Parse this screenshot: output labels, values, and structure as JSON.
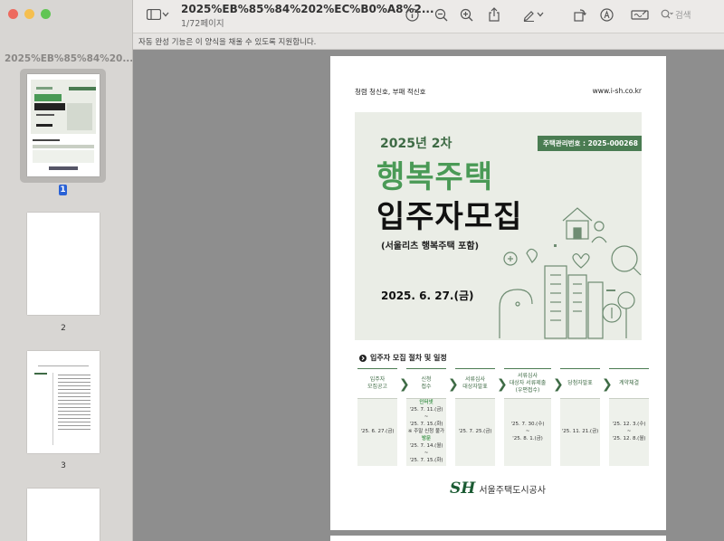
{
  "window": {
    "title": "2025%EB%85%84%202%EC%B0%A8%2...",
    "subtitle": "1/72페이지"
  },
  "sidebar": {
    "doc_label": "2025%EB%85%84%20...",
    "pages": [
      {
        "label": "1",
        "selected": true
      },
      {
        "label": "2",
        "selected": false
      },
      {
        "label": "3",
        "selected": false
      }
    ]
  },
  "toolbar": {
    "icons": [
      "sidebar-icon",
      "chevron-down-icon",
      "info-icon",
      "zoom-out-icon",
      "zoom-in-icon",
      "share-icon",
      "markup-pen-icon",
      "rotate-icon",
      "highlight-icon",
      "signature-icon",
      "search-icon"
    ],
    "search_placeholder": "검색"
  },
  "notice": "자동 완성 기능은 이 양식을 채울 수 있도록 지원합니다.",
  "document": {
    "header_left": "청렴 청신호, 부패 적신호",
    "header_right": "www.i-sh.co.kr",
    "badge": "주택관리번호 : 2025-000268",
    "round": "2025년 2차",
    "title_line1": "행복주택",
    "title_line2": "입주자모집",
    "subtitle": "(서울리츠 행복주택 포함)",
    "date": "2025. 6. 27.(금)",
    "process_title": "입주자 모집 절차 및 일정",
    "steps": [
      {
        "head1": "입주자",
        "head2": "모집공고",
        "head3": "",
        "body": [
          "'25. 6. 27.(금)"
        ]
      },
      {
        "head1": "신청",
        "head2": "접수",
        "head3": "",
        "body_online": "인터넷",
        "body": [
          "'25. 7. 11.(금)",
          "~",
          "'25. 7. 15.(화)",
          "※ 주말 신청 불가"
        ],
        "body_visit": "방문",
        "body2": [
          "'25. 7. 14.(월)",
          "~",
          "'25. 7. 15.(화)"
        ]
      },
      {
        "head1": "서류심사",
        "head2": "대상자발표",
        "head3": "",
        "body": [
          "'25. 7. 25.(금)"
        ]
      },
      {
        "head1": "서류심사",
        "head2": "대상자 서류제출",
        "head3": "(우편접수)",
        "body": [
          "'25. 7. 30.(수)",
          "~",
          "'25. 8. 1.(금)"
        ]
      },
      {
        "head1": "당첨자발표",
        "head2": "",
        "head3": "",
        "body": [
          "'25. 11. 21.(금)"
        ]
      },
      {
        "head1": "계약체결",
        "head2": "",
        "head3": "",
        "body": [
          "'25. 12. 3.(수)",
          "~",
          "'25. 12. 8.(월)"
        ]
      }
    ],
    "footer_mark": "SH",
    "footer_text": "서울주택도시공사"
  },
  "colors": {
    "accent_green": "#4a9a56",
    "dark_green": "#3e6b45",
    "selection_blue": "#2a62d6"
  }
}
